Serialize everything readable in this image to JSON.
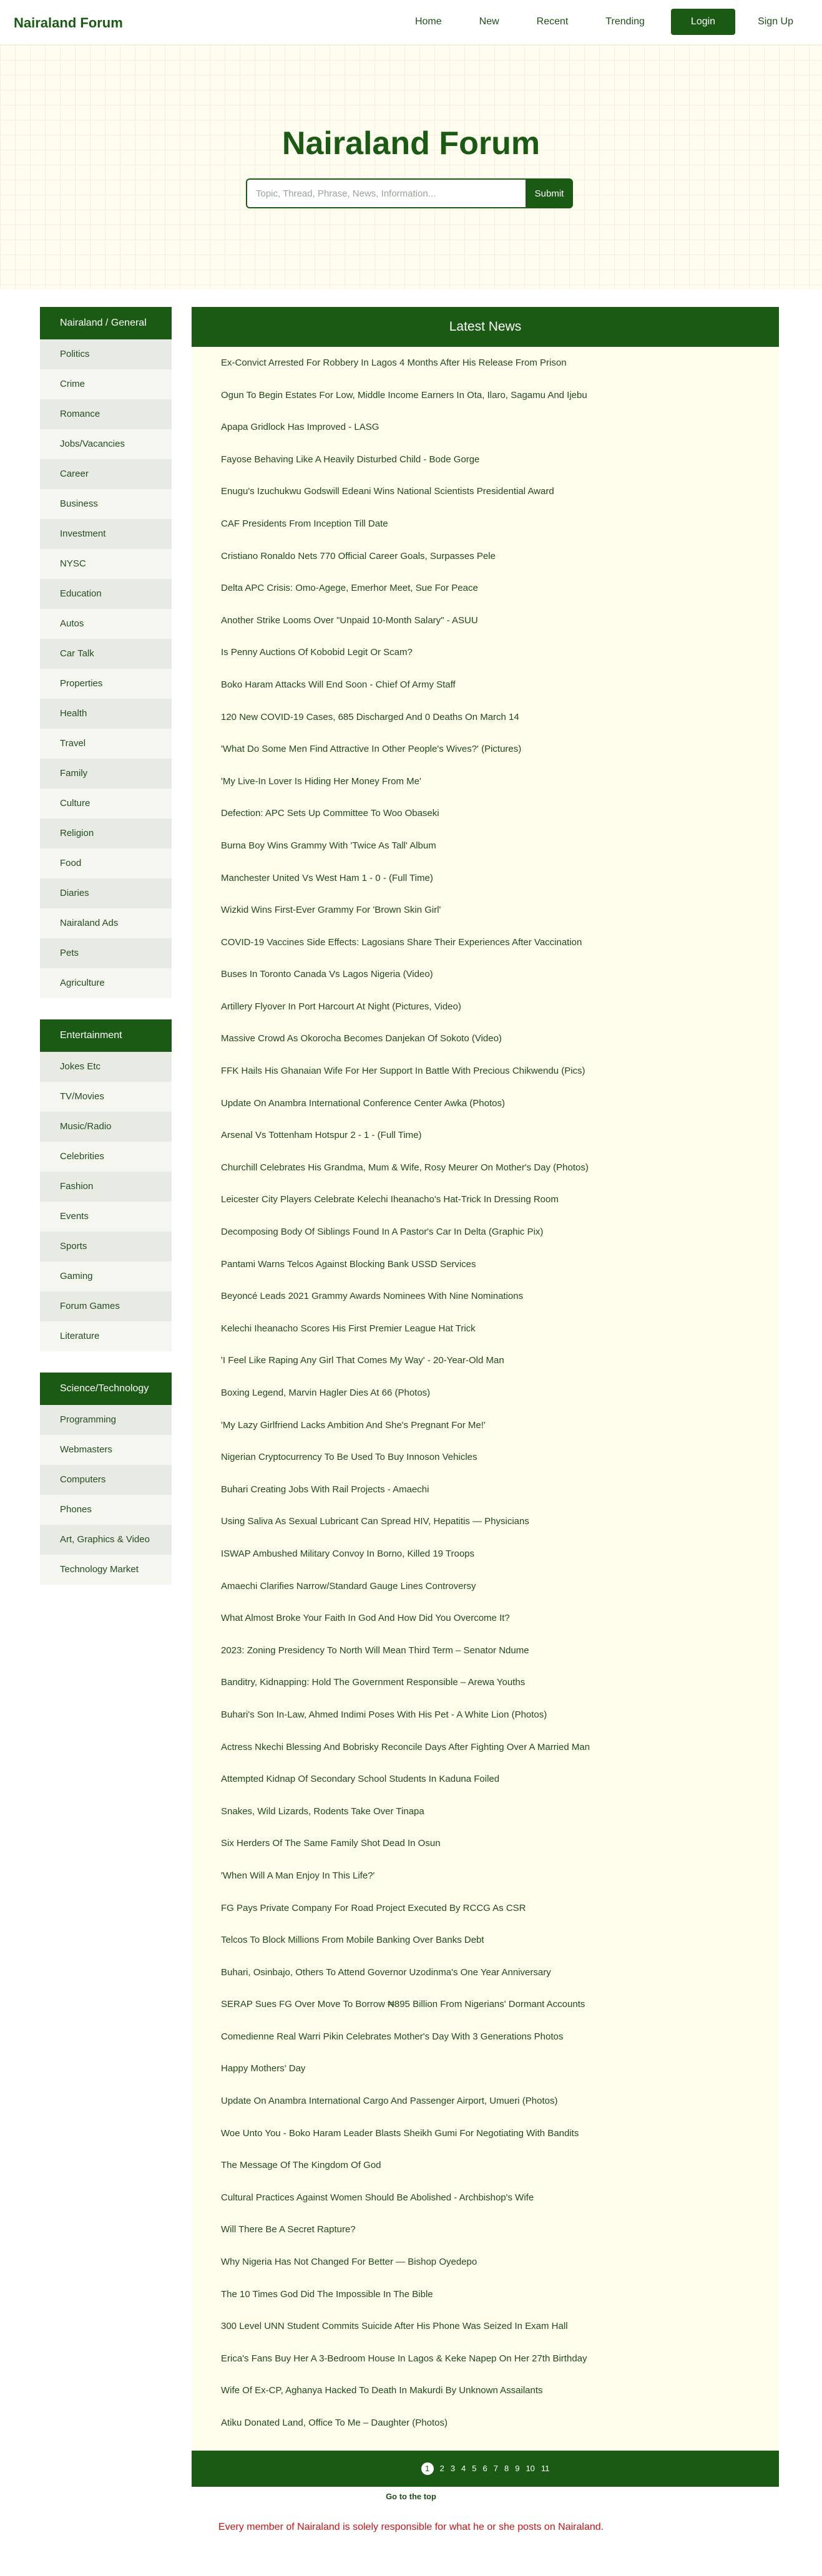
{
  "header": {
    "logo": "Nairaland Forum",
    "nav": [
      "Home",
      "New",
      "Recent",
      "Trending",
      "Login",
      "Sign Up"
    ]
  },
  "hero": {
    "title": "Nairaland Forum",
    "search_placeholder": "Topic, Thread, Phrase, News, Information...",
    "search_button": "Submit"
  },
  "sidebar": [
    {
      "title": "Nairaland / General",
      "items": [
        "Politics",
        "Crime",
        "Romance",
        "Jobs/Vacancies",
        "Career",
        "Business",
        "Investment",
        "NYSC",
        "Education",
        "Autos",
        "Car Talk",
        "Properties",
        "Health",
        "Travel",
        "Family",
        "Culture",
        "Religion",
        "Food",
        "Diaries",
        "Nairaland Ads",
        "Pets",
        "Agriculture"
      ]
    },
    {
      "title": "Entertainment",
      "items": [
        "Jokes Etc",
        "TV/Movies",
        "Music/Radio",
        "Celebrities",
        "Fashion",
        "Events",
        "Sports",
        "Gaming",
        "Forum Games",
        "Literature"
      ]
    },
    {
      "title": "Science/Technology",
      "items": [
        "Programming",
        "Webmasters",
        "Computers",
        "Phones",
        "Art, Graphics & Video",
        "Technology Market"
      ]
    }
  ],
  "news": {
    "title": "Latest News",
    "items": [
      "Ex-Convict Arrested For Robbery In Lagos 4 Months After His Release From Prison",
      "Ogun To Begin Estates For Low, Middle Income Earners In Ota, Ilaro, Sagamu And Ijebu",
      "Apapa Gridlock Has Improved - LASG",
      "Fayose Behaving Like A Heavily Disturbed Child - Bode Gorge",
      "Enugu's Izuchukwu Godswill Edeani Wins National Scientists Presidential Award",
      "CAF Presidents From Inception Till Date",
      "Cristiano Ronaldo Nets 770 Official Career Goals, Surpasses Pele",
      "Delta APC Crisis: Omo-Agege, Emerhor Meet, Sue For Peace",
      "Another Strike Looms Over \"Unpaid 10-Month Salary\" - ASUU",
      "Is Penny Auctions Of Kobobid Legit Or Scam?",
      "Boko Haram Attacks Will End Soon - Chief Of Army Staff",
      "120 New COVID-19 Cases, 685 Discharged And 0 Deaths On March 14",
      "'What Do Some Men Find Attractive In Other People's Wives?' (Pictures)",
      "'My Live-In Lover Is Hiding Her Money From Me'",
      "Defection: APC Sets Up Committee To Woo Obaseki",
      "Burna Boy Wins Grammy With 'Twice As Tall' Album",
      "Manchester United Vs West Ham 1 - 0 - (Full Time)",
      "Wizkid Wins First-Ever Grammy For 'Brown Skin Girl'",
      "COVID-19 Vaccines Side Effects: Lagosians Share Their Experiences After Vaccination",
      "Buses In Toronto Canada Vs Lagos Nigeria (Video)",
      "Artillery Flyover In Port Harcourt At Night (Pictures, Video)",
      "Massive Crowd As Okorocha Becomes Danjekan Of Sokoto (Video)",
      "FFK Hails His Ghanaian Wife For Her Support In Battle With Precious Chikwendu (Pics)",
      "Update On Anambra International Conference Center Awka (Photos)",
      "Arsenal Vs Tottenham Hotspur 2 - 1 - (Full Time)",
      "Churchill Celebrates His Grandma, Mum & Wife, Rosy Meurer On Mother's Day (Photos)",
      "Leicester City Players Celebrate Kelechi Iheanacho's Hat-Trick In Dressing Room",
      "Decomposing Body Of Siblings Found In A Pastor's Car In Delta (Graphic Pix)",
      "Pantami Warns Telcos Against Blocking Bank USSD Services",
      "Beyoncé Leads 2021 Grammy Awards Nominees With Nine Nominations",
      "Kelechi Iheanacho Scores His First Premier League Hat Trick",
      "'I Feel Like Raping Any Girl That Comes My Way' - 20-Year-Old Man",
      "Boxing Legend, Marvin Hagler Dies At 66 (Photos)",
      "'My Lazy Girlfriend Lacks Ambition And She's Pregnant For Me!'",
      "Nigerian Cryptocurrency To Be Used To Buy Innoson Vehicles",
      "Buhari Creating Jobs With Rail Projects - Amaechi",
      "Using Saliva As Sexual Lubricant Can Spread HIV, Hepatitis — Physicians",
      "ISWAP Ambushed Military Convoy In Borno, Killed 19 Troops",
      "Amaechi Clarifies Narrow/Standard Gauge Lines Controversy",
      "What Almost Broke Your Faith In God And How Did You Overcome It?",
      "2023: Zoning Presidency To North Will Mean Third Term – Senator Ndume",
      "Banditry, Kidnapping: Hold The Government Responsible – Arewa Youths",
      "Buhari's Son In-Law, Ahmed Indimi Poses With His Pet - A White Lion (Photos)",
      "Actress Nkechi Blessing And Bobrisky Reconcile Days After Fighting Over A Married Man",
      "Attempted Kidnap Of Secondary School Students In Kaduna Foiled",
      "Snakes, Wild Lizards, Rodents Take Over Tinapa",
      "Six Herders Of The Same Family Shot Dead In Osun",
      "'When Will A Man Enjoy In This Life?'",
      "FG Pays Private Company For Road Project Executed By RCCG As CSR",
      "Telcos To Block Millions From Mobile Banking Over Banks Debt",
      "Buhari, Osinbajo, Others To Attend Governor Uzodinma's One Year Anniversary",
      "SERAP Sues FG Over Move To Borrow ₦895 Billion From Nigerians' Dormant Accounts",
      "Comedienne Real Warri Pikin Celebrates Mother's Day With 3 Generations Photos",
      "Happy Mothers' Day",
      "Update On Anambra International Cargo And Passenger Airport, Umueri (Photos)",
      "Woe Unto You - Boko Haram Leader Blasts Sheikh Gumi For Negotiating With Bandits",
      "The Message Of The Kingdom Of God",
      "Cultural Practices Against Women Should Be Abolished - Archbishop's Wife",
      "Will There Be A Secret Rapture?",
      "Why Nigeria Has Not Changed For Better — Bishop Oyedepo",
      "The 10 Times God Did The Impossible In The Bible",
      "300 Level UNN Student Commits Suicide After His Phone Was Seized In Exam Hall",
      "Erica's Fans Buy Her A 3-Bedroom House In Lagos & Keke Napep On Her 27th Birthday",
      "Wife Of Ex-CP, Aghanya Hacked To Death In Makurdi By Unknown Assailants",
      "Atiku Donated Land, Office To Me – Daughter (Photos)"
    ]
  },
  "pagination": {
    "current": "1",
    "pages": [
      "1",
      "2",
      "3",
      "4",
      "5",
      "6",
      "7",
      "8",
      "9",
      "10",
      "11"
    ]
  },
  "footer": {
    "to_top": "Go to the top",
    "note": "Every member of Nairaland is solely responsible for what he or she posts on Nairaland."
  }
}
